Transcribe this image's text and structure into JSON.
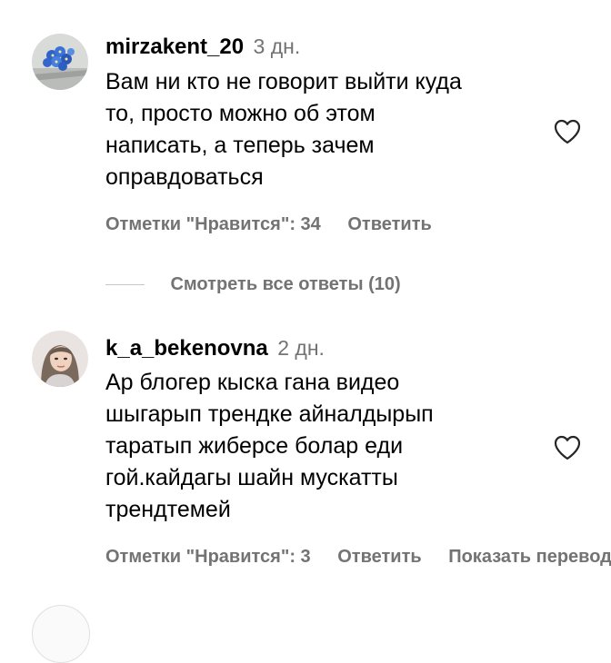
{
  "comments": [
    {
      "username": "mirzakent_20",
      "timestamp": "3 дн.",
      "avatar": "blue-flowers-avatar",
      "lines": [
        "Вам ни кто не говорит выйти куда",
        "то, просто можно об этом",
        "написать, а теперь зачем",
        "оправдоваться"
      ],
      "likes_label": "Отметки \"Нравится\": 34",
      "reply_label": "Ответить",
      "view_replies_label": "Смотреть все ответы (10)"
    },
    {
      "username": "k_a_bekenovna",
      "timestamp": "2 дн.",
      "avatar": "woman-portrait-avatar",
      "lines": [
        "Ар блогер кыска гана видео",
        "шыгарып трендке айналдырып",
        "таратып жиберсе болар еди",
        "гой.кайдагы шайн мускатты",
        "трендтемей"
      ],
      "likes_label": "Отметки \"Нравится\": 3",
      "reply_label": "Ответить",
      "translate_label": "Показать перевод"
    }
  ],
  "icons": {
    "like": "heart-outline-icon"
  },
  "colors": {
    "text": "#000000",
    "secondary": "#737373",
    "divider": "#c7c7c7"
  }
}
